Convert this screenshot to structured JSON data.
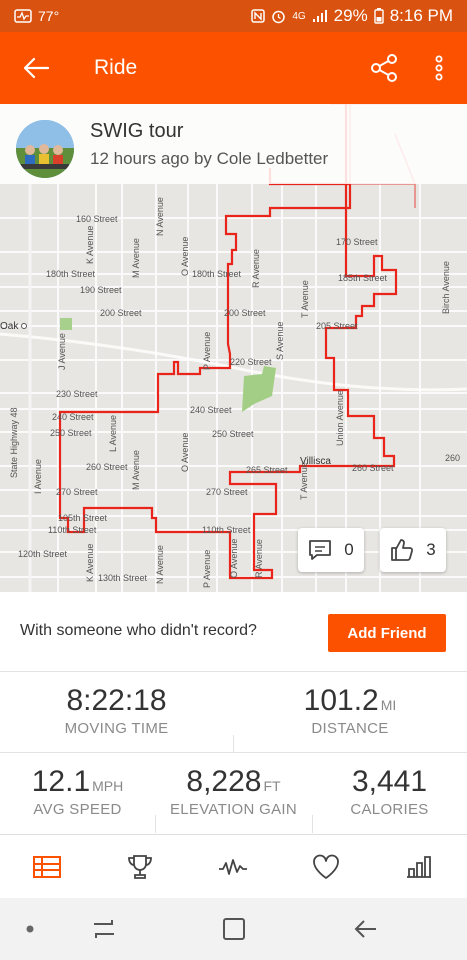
{
  "status_bar": {
    "temperature": "77°",
    "network": "4G",
    "battery": "29%",
    "time": "8:16 PM"
  },
  "app_bar": {
    "title": "Ride",
    "icons": [
      "back-arrow-icon",
      "share-icon",
      "more-vertical-icon"
    ]
  },
  "activity": {
    "name": "SWIG tour",
    "subtitle": "12 hours ago by Cole Ledbetter",
    "comments_count": "0",
    "kudos_count": "3"
  },
  "map": {
    "streets": {
      "s160": "160 Street",
      "s170": "170 Street",
      "s180": "180th Street",
      "s180b": "180th Street",
      "s185": "185th Street",
      "s190": "190 Street",
      "s200": "200 Street",
      "s200b": "200 Street",
      "s205": "205 Street",
      "s220": "220 Street",
      "s230": "230 Street",
      "s240": "240 Street",
      "s240b": "240 Street",
      "s250": "250 Street",
      "s250b": "250 Street",
      "s260": "260 Street",
      "s260b": "260 Street",
      "s260c": "260",
      "s265": "265 Street",
      "s270": "270 Street",
      "s270b": "270 Street",
      "s105": "105th Street",
      "s110": "110th Street",
      "s110b": "110th Street",
      "s120": "120th Street",
      "s130": "130th Street"
    },
    "avenues": {
      "k": "K Avenue",
      "k2": "K Avenue",
      "n": "N Avenue",
      "n2": "N Avenue",
      "m": "M Avenue",
      "m2": "M Avenue",
      "o": "O Avenue",
      "o2": "O Avenue",
      "o3": "O Avenue",
      "r": "R Avenue",
      "r2": "R Avenue",
      "p": "P Avenue",
      "p2": "P Avenue",
      "s": "S Avenue",
      "t": "T Avenue",
      "t2": "T Avenue",
      "j": "J Avenue",
      "i": "I Avenue",
      "l": "L Avenue",
      "union": "Union Avenue",
      "birch": "Birch Avenue",
      "hwy48": "State Highway 48"
    },
    "places": {
      "oak": "Oak",
      "villisca": "Villisca"
    },
    "route_color": "#e8241b"
  },
  "friend_prompt": {
    "text": "With someone who didn't record?",
    "button": "Add Friend"
  },
  "stats": {
    "moving_time": {
      "value": "8:22:18",
      "label": "MOVING TIME"
    },
    "distance": {
      "value": "101.2",
      "unit": "MI",
      "label": "DISTANCE"
    },
    "avg_speed": {
      "value": "12.1",
      "unit": "MPH",
      "label": "AVG SPEED"
    },
    "elevation_gain": {
      "value": "8,228",
      "unit": "FT",
      "label": "ELEVATION GAIN"
    },
    "calories": {
      "value": "3,441",
      "label": "CALORIES"
    }
  },
  "tabs": [
    "overview-icon",
    "trophy-icon",
    "analysis-icon",
    "heart-icon",
    "bar-chart-icon"
  ],
  "system_nav": [
    "dot-icon",
    "recents-icon",
    "home-icon",
    "back-icon"
  ],
  "colors": {
    "brand": "#fc5200",
    "status_bar": "#d9520f"
  }
}
